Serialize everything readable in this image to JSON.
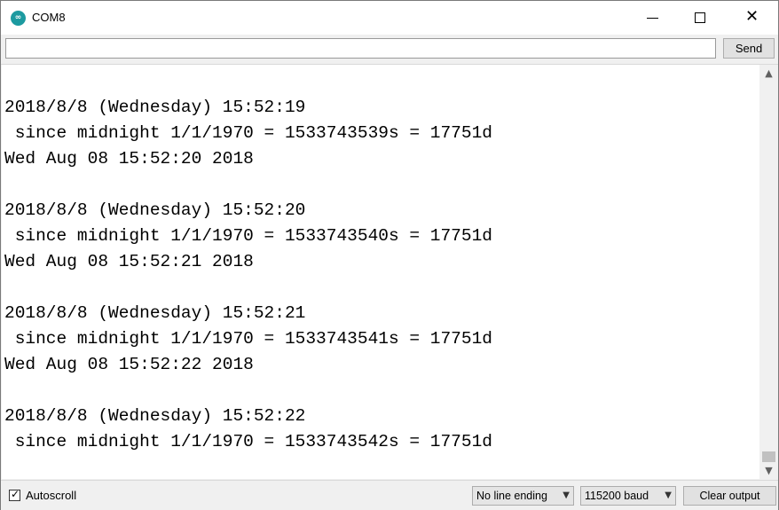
{
  "window": {
    "title": "COM8",
    "minimize_icon": "minimize-icon",
    "maximize_icon": "maximize-icon",
    "close_icon": "close-icon",
    "close_glyph": "✕"
  },
  "toolbar": {
    "input_value": "",
    "send_label": "Send"
  },
  "output": {
    "cut_top_line": "  ·    ·",
    "lines": [
      "2018/8/8 (Wednesday) 15:52:19",
      " since midnight 1/1/1970 = 1533743539s = 17751d",
      "Wed Aug 08 15:52:20 2018",
      "",
      "2018/8/8 (Wednesday) 15:52:20",
      " since midnight 1/1/1970 = 1533743540s = 17751d",
      "Wed Aug 08 15:52:21 2018",
      "",
      "2018/8/8 (Wednesday) 15:52:21",
      " since midnight 1/1/1970 = 1533743541s = 17751d",
      "Wed Aug 08 15:52:22 2018",
      "",
      "2018/8/8 (Wednesday) 15:52:22",
      " since midnight 1/1/1970 = 1533743542s = 17751d"
    ]
  },
  "statusbar": {
    "autoscroll_label": "Autoscroll",
    "autoscroll_checked": true,
    "line_ending_selected": "No line ending",
    "baud_selected": "115200 baud",
    "clear_label": "Clear output"
  },
  "colors": {
    "app_icon": "#1c9aa0",
    "chrome_bg": "#f0f0f0"
  }
}
